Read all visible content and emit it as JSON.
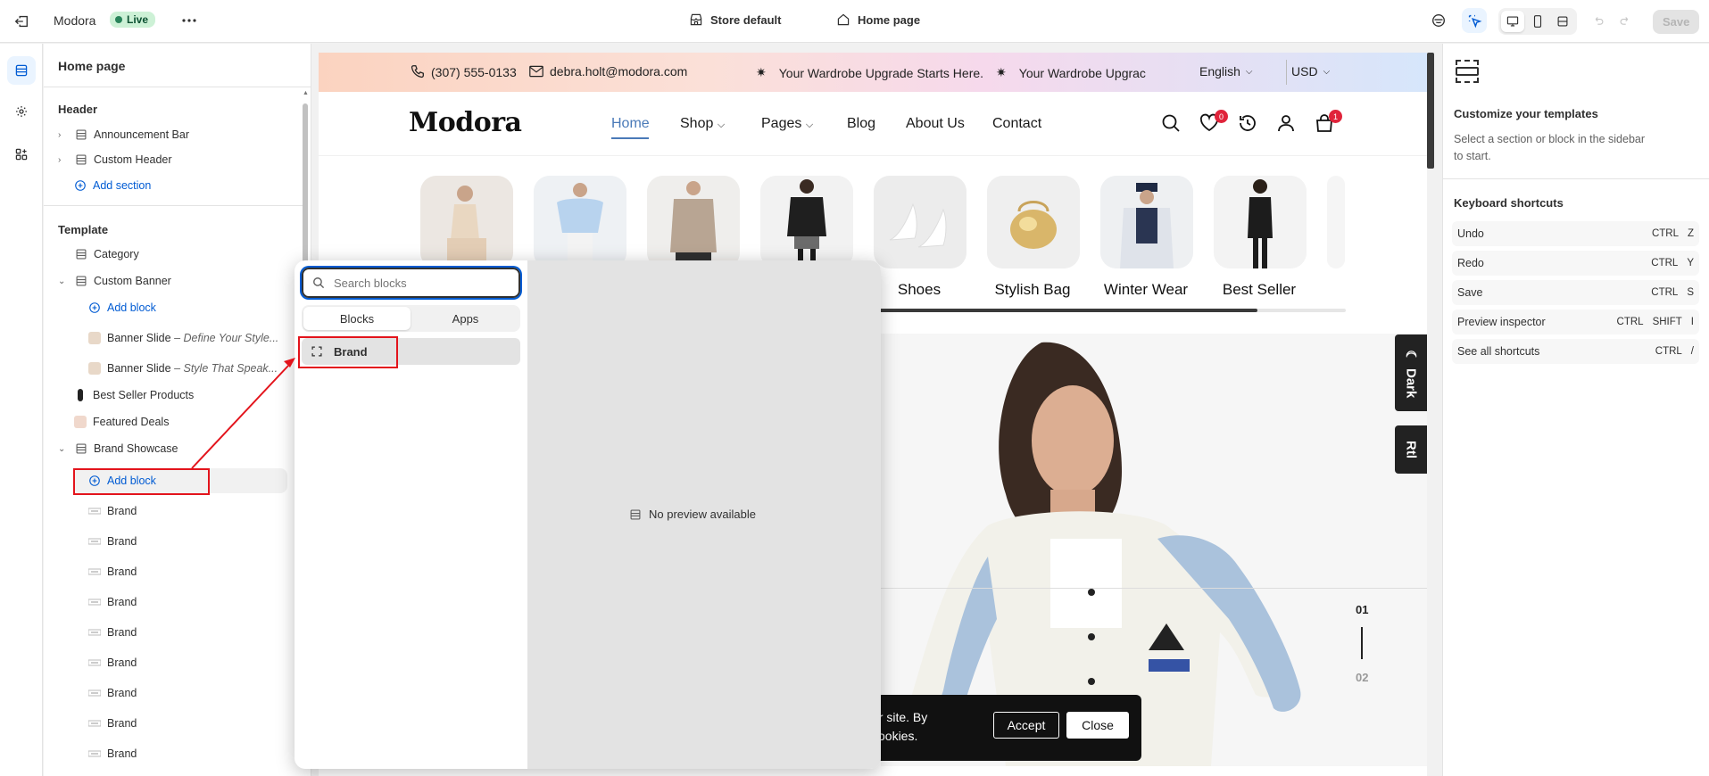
{
  "topbar": {
    "store_name": "Modora",
    "status_badge": "Live",
    "theme_label": "Store default",
    "page_label": "Home page",
    "save_label": "Save"
  },
  "sidebar": {
    "title": "Home page",
    "header_group": "Header",
    "header_items": [
      "Announcement Bar",
      "Custom Header"
    ],
    "add_section": "Add section",
    "template_group": "Template",
    "category": "Category",
    "custom_banner": "Custom Banner",
    "add_block": "Add block",
    "banner_slides": [
      {
        "label": "Banner Slide",
        "sub": "– Define Your Style..."
      },
      {
        "label": "Banner Slide",
        "sub": "– Style That Speak..."
      }
    ],
    "best_seller": "Best Seller Products",
    "featured_deals": "Featured Deals",
    "brand_showcase": "Brand Showcase",
    "add_block_2": "Add block",
    "brand_items": [
      "Brand",
      "Brand",
      "Brand",
      "Brand",
      "Brand",
      "Brand",
      "Brand",
      "Brand",
      "Brand"
    ]
  },
  "popup": {
    "search_placeholder": "Search blocks",
    "tabs": [
      "Blocks",
      "Apps"
    ],
    "active_tab": "Blocks",
    "result_item": "Brand",
    "no_preview": "No preview available"
  },
  "preview": {
    "announcement": {
      "phone": "(307) 555-0133",
      "email": "debra.holt@modora.com",
      "ticker_1": "Your Wardrobe Upgrade Starts Here.",
      "ticker_2": "Your Wardrobe Upgrac",
      "language": "English",
      "currency": "USD"
    },
    "logo": "Modora",
    "nav": [
      "Home",
      "Shop",
      "Pages",
      "Blog",
      "About Us",
      "Contact"
    ],
    "wishlist_count": "0",
    "cart_count": "1",
    "categories": [
      "Shoes",
      "Stylish Bag",
      "Winter Wear",
      "Best Seller"
    ],
    "side_tabs": [
      "Dark",
      "Rtl"
    ],
    "slide_current": "01",
    "slide_next": "02",
    "cookie_text_1": "ur site. By",
    "cookie_text_2": "cookies.",
    "cookie_accept": "Accept",
    "cookie_close": "Close"
  },
  "right_panel": {
    "title": "Customize your templates",
    "desc_line_1": "Select a section or block in the sidebar",
    "desc_line_2": "to start.",
    "shortcuts_title": "Keyboard shortcuts",
    "shortcuts": [
      {
        "label": "Undo",
        "keys": [
          "CTRL",
          "Z"
        ]
      },
      {
        "label": "Redo",
        "keys": [
          "CTRL",
          "Y"
        ]
      },
      {
        "label": "Save",
        "keys": [
          "CTRL",
          "S"
        ]
      },
      {
        "label": "Preview inspector",
        "keys": [
          "CTRL",
          "SHIFT",
          "I"
        ]
      },
      {
        "label": "See all shortcuts",
        "keys": [
          "CTRL",
          "/"
        ]
      }
    ]
  },
  "colors": {
    "accent_blue": "#005bd3",
    "live_green": "#29845a",
    "annotation_red": "#e3141c",
    "badge_red": "#e0243b"
  }
}
